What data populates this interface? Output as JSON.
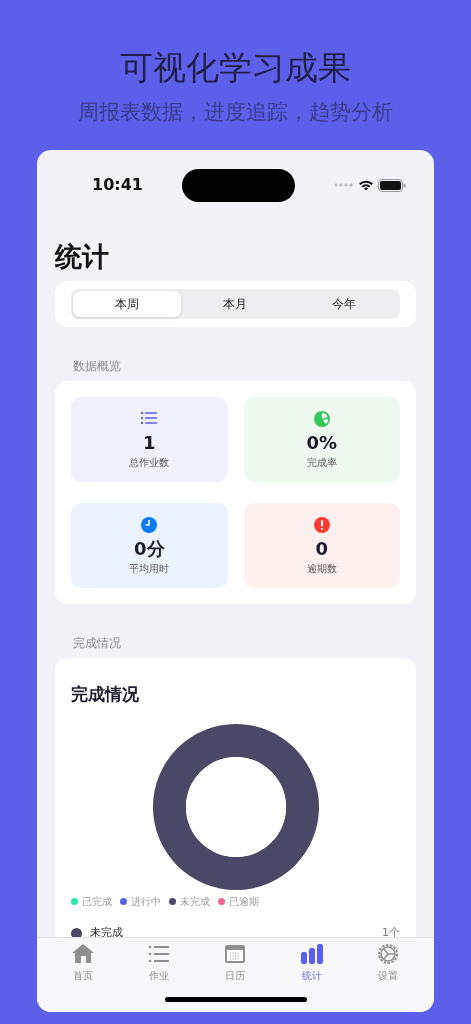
{
  "header": {
    "title": "可视化学习成果",
    "subtitle": "周报表数据，进度追踪，趋势分析"
  },
  "status_bar": {
    "time": "10:41"
  },
  "page_title": "统计",
  "period_tabs": [
    {
      "label": "本周",
      "selected": true
    },
    {
      "label": "本月",
      "selected": false
    },
    {
      "label": "今年",
      "selected": false
    }
  ],
  "overview": {
    "heading": "数据概览",
    "tiles": [
      {
        "kind": "list",
        "value": "1",
        "label": "总作业数"
      },
      {
        "kind": "pie",
        "value": "0%",
        "label": "完成率"
      },
      {
        "kind": "clock",
        "value": "0分",
        "label": "平均用时"
      },
      {
        "kind": "alert",
        "value": "0",
        "label": "逾期数"
      }
    ]
  },
  "completion": {
    "heading": "完成情况",
    "card_title": "完成情况",
    "chart_data": {
      "type": "donut",
      "values": [
        0,
        0,
        1,
        0
      ]
    },
    "legend": [
      {
        "label": "已完成",
        "color": "#2ee8a5"
      },
      {
        "label": "进行中",
        "color": "#5b5ff0"
      },
      {
        "label": "未完成",
        "color": "#4a4866"
      },
      {
        "label": "已逾期",
        "color": "#f2648f"
      }
    ],
    "breakdown": [
      {
        "label": "未完成",
        "count": "1个",
        "color": "#4a4866"
      }
    ]
  },
  "tab_bar": [
    {
      "kind": "home",
      "label": "首页",
      "selected": false
    },
    {
      "kind": "list",
      "label": "作业",
      "selected": false
    },
    {
      "kind": "calendar",
      "label": "日历",
      "selected": false
    },
    {
      "kind": "stats",
      "label": "统计",
      "selected": true
    },
    {
      "kind": "settings",
      "label": "设置",
      "selected": false
    }
  ]
}
